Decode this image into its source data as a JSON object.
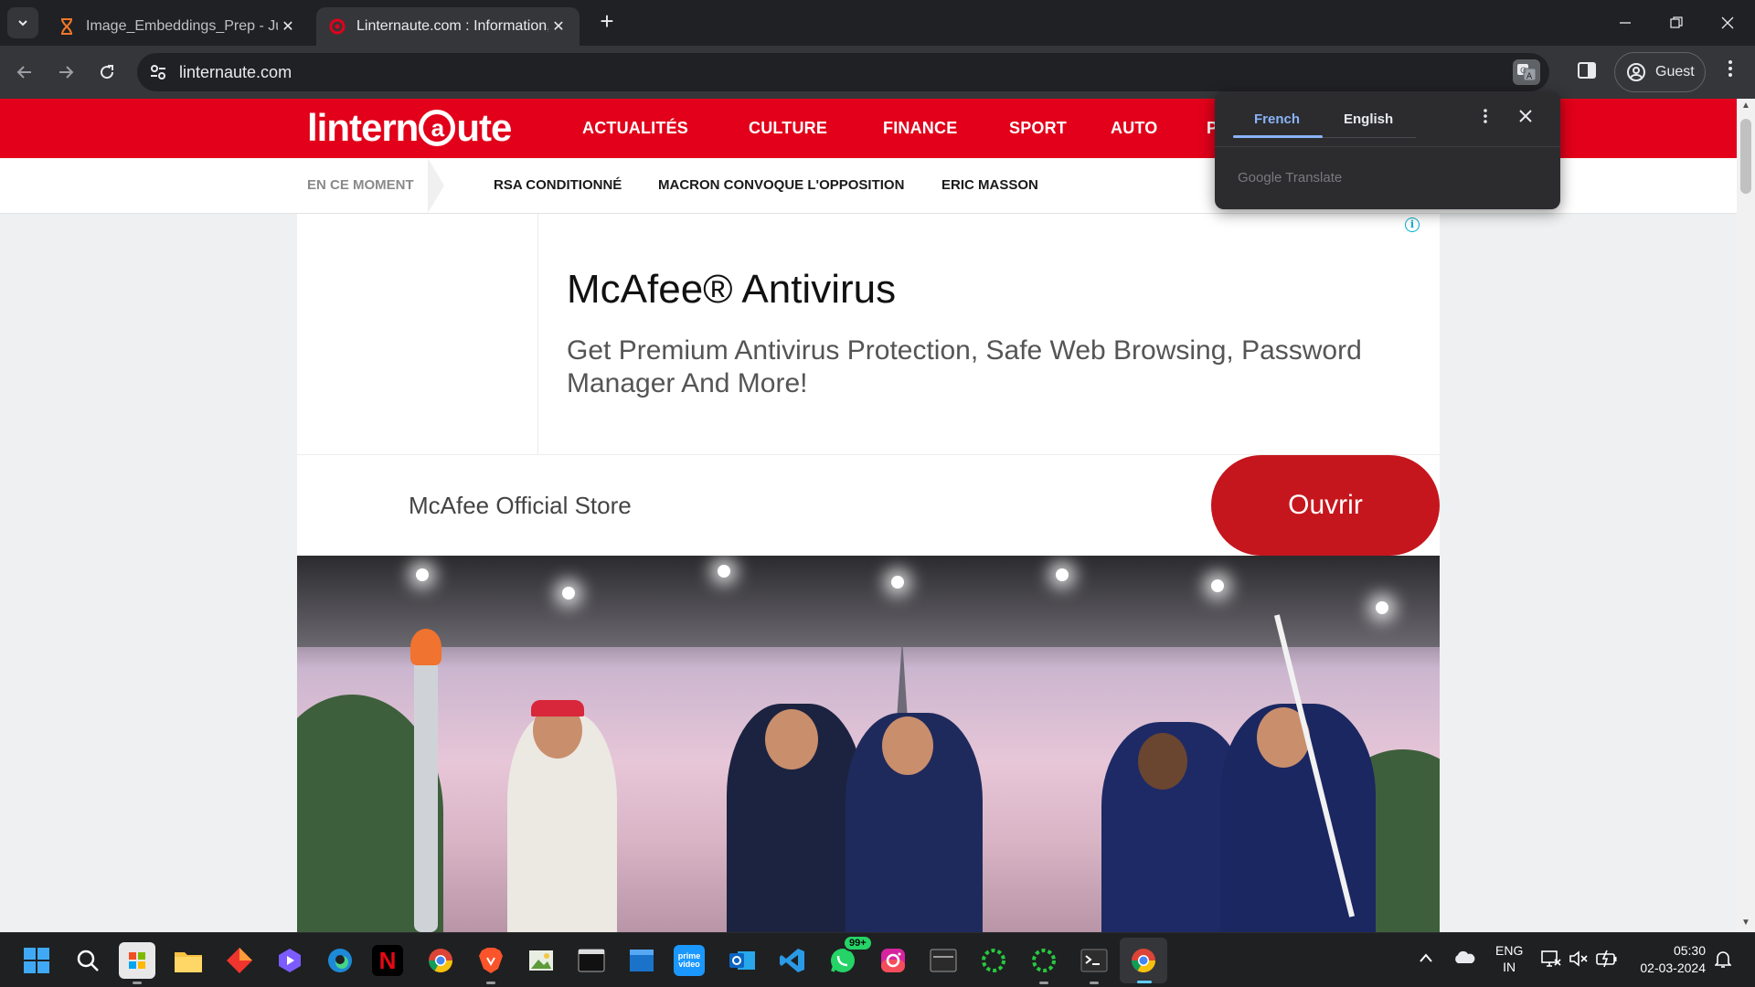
{
  "browser": {
    "tabs": [
      {
        "title": "Image_Embeddings_Prep - Jupy",
        "active": false
      },
      {
        "title": "Linternaute.com : Information, l",
        "active": true
      }
    ],
    "url": "linternaute.com",
    "guest_label": "Guest"
  },
  "site": {
    "logo_text_start": "lintern",
    "logo_text_end": "ute",
    "nav": [
      "ACTUALITÉS",
      "CULTURE",
      "FINANCE",
      "SPORT",
      "AUTO",
      "P"
    ],
    "subbar_label": "EN CE MOMENT",
    "trending": [
      "RSA CONDITIONNÉ",
      "MACRON CONVOQUE L'OPPOSITION",
      "ERIC MASSON"
    ]
  },
  "ad": {
    "title": "McAfee® Antivirus",
    "description": "Get Premium Antivirus Protection, Safe Web Browsing, Password Manager And More!",
    "store": "McAfee Official Store",
    "cta": "Ouvrir",
    "info": "i"
  },
  "translate_popup": {
    "source_lang": "French",
    "target_lang": "English",
    "brand": "Google Translate"
  },
  "taskbar": {
    "whatsapp_badge": "99+",
    "language_top": "ENG",
    "language_bottom": "IN",
    "time": "05:30",
    "date": "02-03-2024"
  },
  "colors": {
    "brand_red": "#e2001a",
    "cta_red": "#c5161d",
    "translate_accent": "#8ab4f8"
  }
}
